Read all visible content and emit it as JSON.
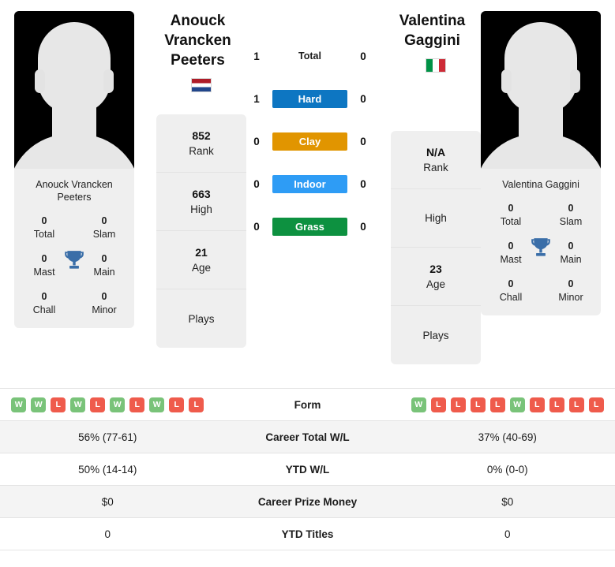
{
  "players": {
    "left": {
      "display_name": "Anouck Vrancken Peeters",
      "header_name": "Anouck Vrancken Peeters",
      "country": "Netherlands",
      "flag_icon": "flag-netherlands-icon",
      "stats": [
        {
          "value": "852",
          "label": "Rank"
        },
        {
          "value": "663",
          "label": "High"
        },
        {
          "value": "21",
          "label": "Age"
        },
        {
          "value": "",
          "label": "Plays"
        }
      ],
      "titles": [
        {
          "value": "0",
          "label": "Total"
        },
        {
          "value": "0",
          "label": "Slam"
        },
        {
          "value": "0",
          "label": "Mast"
        },
        {
          "value": "0",
          "label": "Main"
        },
        {
          "value": "0",
          "label": "Chall"
        },
        {
          "value": "0",
          "label": "Minor"
        }
      ],
      "form": [
        "W",
        "W",
        "L",
        "W",
        "L",
        "W",
        "L",
        "W",
        "L",
        "L"
      ],
      "career_total_wl": "56% (77-61)",
      "ytd_wl": "50% (14-14)",
      "career_prize_money": "$0",
      "ytd_titles": "0"
    },
    "right": {
      "display_name": "Valentina Gaggini",
      "header_name": "Valentina Gaggini",
      "country": "Italy",
      "flag_icon": "flag-italy-icon",
      "stats": [
        {
          "value": "N/A",
          "label": "Rank"
        },
        {
          "value": "",
          "label": "High"
        },
        {
          "value": "23",
          "label": "Age"
        },
        {
          "value": "",
          "label": "Plays"
        }
      ],
      "titles": [
        {
          "value": "0",
          "label": "Total"
        },
        {
          "value": "0",
          "label": "Slam"
        },
        {
          "value": "0",
          "label": "Mast"
        },
        {
          "value": "0",
          "label": "Main"
        },
        {
          "value": "0",
          "label": "Chall"
        },
        {
          "value": "0",
          "label": "Minor"
        }
      ],
      "form": [
        "W",
        "L",
        "L",
        "L",
        "L",
        "W",
        "L",
        "L",
        "L",
        "L"
      ],
      "career_total_wl": "37% (40-69)",
      "ytd_wl": "0% (0-0)",
      "career_prize_money": "$0",
      "ytd_titles": "0"
    }
  },
  "head_to_head": [
    {
      "label": "Total",
      "left": "1",
      "right": "0",
      "color": "transparent",
      "style": "plain"
    },
    {
      "label": "Hard",
      "left": "1",
      "right": "0",
      "color": "#0d76c2",
      "style": "bar"
    },
    {
      "label": "Clay",
      "left": "0",
      "right": "0",
      "color": "#e19500",
      "style": "bar"
    },
    {
      "label": "Indoor",
      "left": "0",
      "right": "0",
      "color": "#2e9cf5",
      "style": "bar"
    },
    {
      "label": "Grass",
      "left": "0",
      "right": "0",
      "color": "#0d9140",
      "style": "bar"
    }
  ],
  "table_rows": [
    {
      "label": "Form",
      "type": "form",
      "shaded": false
    },
    {
      "label": "Career Total W/L",
      "type": "text",
      "shaded": true,
      "left": "56% (77-61)",
      "right": "37% (40-69)"
    },
    {
      "label": "YTD W/L",
      "type": "text",
      "shaded": false,
      "left": "50% (14-14)",
      "right": "0% (0-0)"
    },
    {
      "label": "Career Prize Money",
      "type": "text",
      "shaded": true,
      "left": "$0",
      "right": "$0"
    },
    {
      "label": "YTD Titles",
      "type": "text",
      "shaded": false,
      "left": "0",
      "right": "0"
    }
  ],
  "icons": {
    "trophy": "trophy-icon",
    "avatar": "player-avatar-silhouette-icon"
  },
  "colors": {
    "hard": "#0d76c2",
    "clay": "#e19500",
    "indoor": "#2e9cf5",
    "grass": "#0d9140",
    "win_badge": "#79c379",
    "loss_badge": "#ef5b4c",
    "trophy": "#3a6ea8"
  }
}
